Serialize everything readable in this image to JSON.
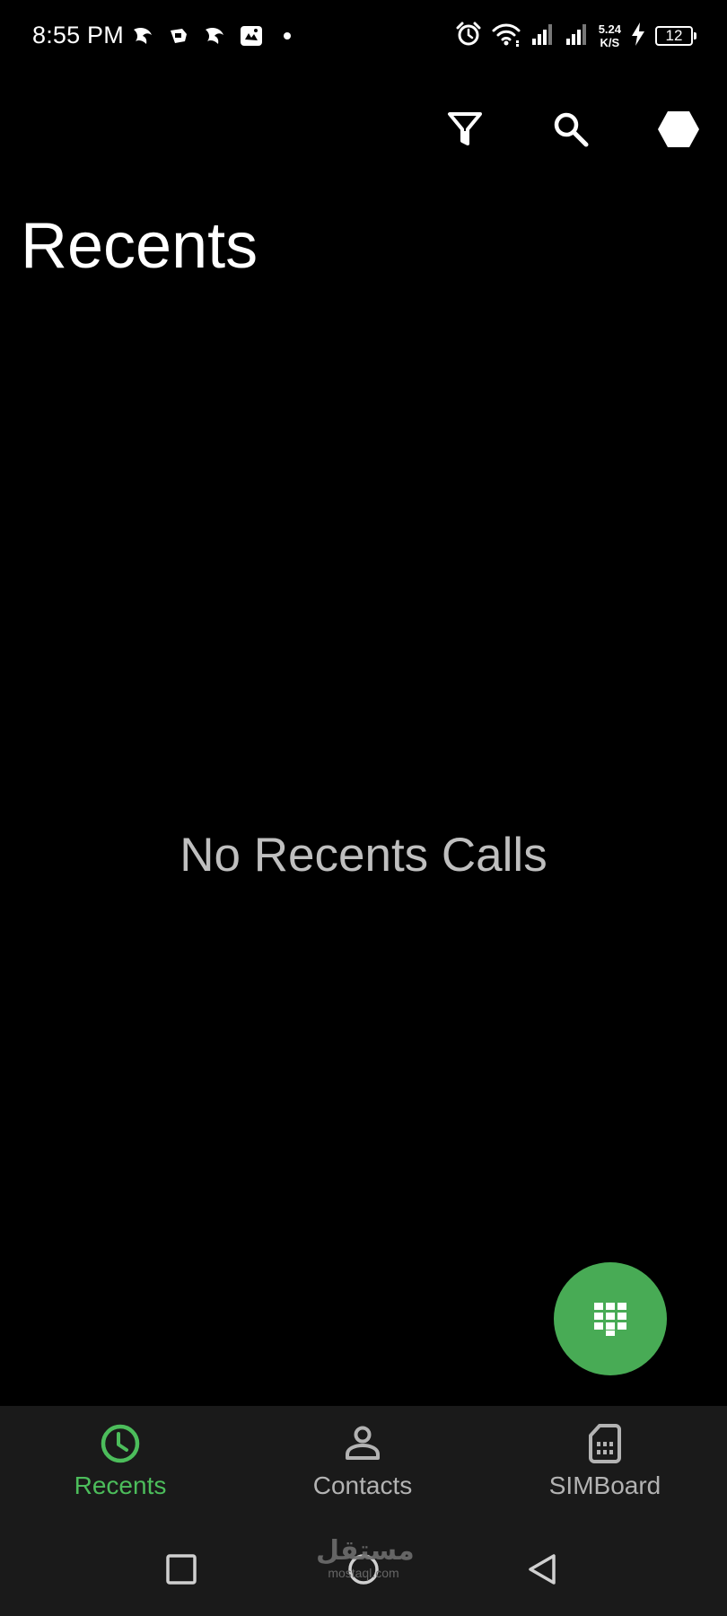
{
  "status_bar": {
    "time": "8:55 PM",
    "net_speed_value": "5.24",
    "net_speed_unit": "K/S",
    "battery_level": "12",
    "notification_icons": [
      "falcon-app-icon",
      "chat-badge-icon",
      "falcon-app-icon",
      "gallery-app-icon"
    ]
  },
  "toolbar": {
    "filter_icon": "filter-icon",
    "search_icon": "search-icon",
    "menu_icon": "hexagon-menu-icon"
  },
  "page": {
    "title": "Recents",
    "empty_message": "No Recents Calls"
  },
  "fab": {
    "icon": "dialpad-icon",
    "color": "#48ab55"
  },
  "bottom_nav": {
    "tabs": [
      {
        "label": "Recents",
        "icon": "clock-icon",
        "active": true
      },
      {
        "label": "Contacts",
        "icon": "person-icon",
        "active": false
      },
      {
        "label": "SIMBoard",
        "icon": "sim-card-icon",
        "active": false
      }
    ],
    "active_color": "#4cbd5b",
    "inactive_color": "#b3b3b3"
  },
  "watermark": {
    "arabic": "مستقل",
    "latin": "mostaql.com"
  }
}
